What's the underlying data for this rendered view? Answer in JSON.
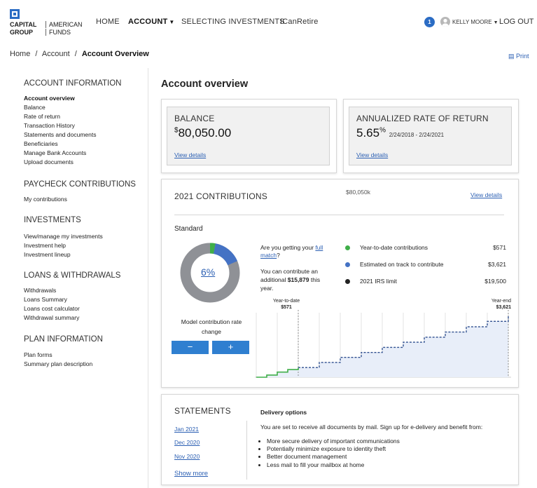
{
  "header": {
    "logo_line1": "CAPITAL",
    "logo_line2": "GROUP",
    "logo_right1": "AMERICAN",
    "logo_right2": "FUNDS",
    "nav": [
      {
        "label": "HOME"
      },
      {
        "label": "ACCOUNT"
      },
      {
        "label": "SELECTING INVESTMENTS"
      },
      {
        "label": "ICanRetire"
      }
    ],
    "notification_count": "1",
    "user_name": "KELLY MOORE",
    "logout_label": "LOG OUT"
  },
  "breadcrumb": {
    "home": "Home",
    "account": "Account",
    "current": "Account Overview",
    "separator": "/"
  },
  "print_label": "Print",
  "sidebar": {
    "sections": [
      {
        "title": "ACCOUNT INFORMATION",
        "items": [
          "Account overview",
          "Balance",
          "Rate of return",
          "Transaction History",
          "Statements and documents",
          "Beneficiaries",
          "Manage Bank Accounts",
          "Upload documents"
        ]
      },
      {
        "title": "PAYCHECK CONTRIBUTIONS",
        "items": [
          "My contributions"
        ]
      },
      {
        "title": "INVESTMENTS",
        "items": [
          "View/manage my investments",
          "Investment help",
          "Investment lineup"
        ]
      },
      {
        "title": "LOANS & WITHDRAWALS",
        "items": [
          "Withdrawals",
          "Loans Summary",
          "Loans cost calculator",
          "Withdrawal summary"
        ]
      },
      {
        "title": "PLAN INFORMATION",
        "items": [
          "Plan forms",
          "Summary plan description"
        ]
      }
    ]
  },
  "main": {
    "title": "Account overview",
    "balance": {
      "label": "BALANCE",
      "currency": "$",
      "amount": "80,050.00",
      "link": "View details"
    },
    "rate": {
      "label": "ANNUALIZED RATE OF RETURN",
      "value": "5.65",
      "unit": "%",
      "period": "2/24/2018 - 2/24/2021",
      "link": "View details"
    },
    "contributions": {
      "title": "2021 CONTRIBUTIONS",
      "note": "$80,050k",
      "link": "View details",
      "plan": "Standard",
      "rate": "6%",
      "question_pre": "Are you getting your ",
      "question_link1": "full",
      "question_link2": "match",
      "question_post": "?",
      "text_line1": "You can contribute an",
      "text_pre": "additional ",
      "text_amount": "$15,879",
      "text_post": " this",
      "text_line3": "year.",
      "model_line1": "Model contribution rate",
      "model_line2": "change",
      "minus": "−",
      "plus": "+",
      "colors": {
        "ytd": "#3fae49",
        "estimated": "#4472c4",
        "limit": "#222222",
        "track": "#8f9196"
      },
      "legend": [
        {
          "name": "Year-to-date contributions",
          "value": "$571"
        },
        {
          "name": "Estimated on track to contribute",
          "value": "$3,621"
        },
        {
          "name": "2021 IRS limit",
          "value": "$19,500"
        }
      ]
    },
    "statements": {
      "title": "STATEMENTS",
      "links": [
        "Jan 2021",
        "Dec 2020",
        "Nov 2020"
      ],
      "show_more": "Show more",
      "delivery_title": "Delivery options",
      "delivery_text": "You are set to receive all documents by mail. Sign up for e-delivery and benefit from:",
      "benefits": [
        "More secure delivery of important communications",
        "Potentially minimize exposure to identity theft",
        "Better document management",
        "Less mail to fill your mailbox at home"
      ]
    }
  },
  "chart_data": {
    "type": "line",
    "title": "",
    "xlabel": "",
    "ylabel": "",
    "annotations": [
      {
        "label": "Year-to-date",
        "value": "$571"
      },
      {
        "label": "Year-end",
        "value": "$3,621"
      }
    ],
    "x": [
      0,
      1,
      2,
      3,
      4,
      5,
      6,
      7,
      8,
      9,
      10,
      11,
      12
    ],
    "ylim": [
      0,
      3800
    ],
    "series": [
      {
        "name": "Year-to-date contributions",
        "x": [
          0,
          0.5,
          1,
          1.5,
          2
        ],
        "values": [
          0,
          130,
          300,
          450,
          571
        ]
      },
      {
        "name": "Estimated on track to contribute",
        "x": [
          2,
          3,
          4,
          5,
          6,
          7,
          8,
          9,
          10,
          11,
          12
        ],
        "values": [
          571,
          870,
          1170,
          1460,
          1760,
          2060,
          2360,
          2660,
          2970,
          3290,
          3621
        ]
      }
    ],
    "grid": true
  }
}
